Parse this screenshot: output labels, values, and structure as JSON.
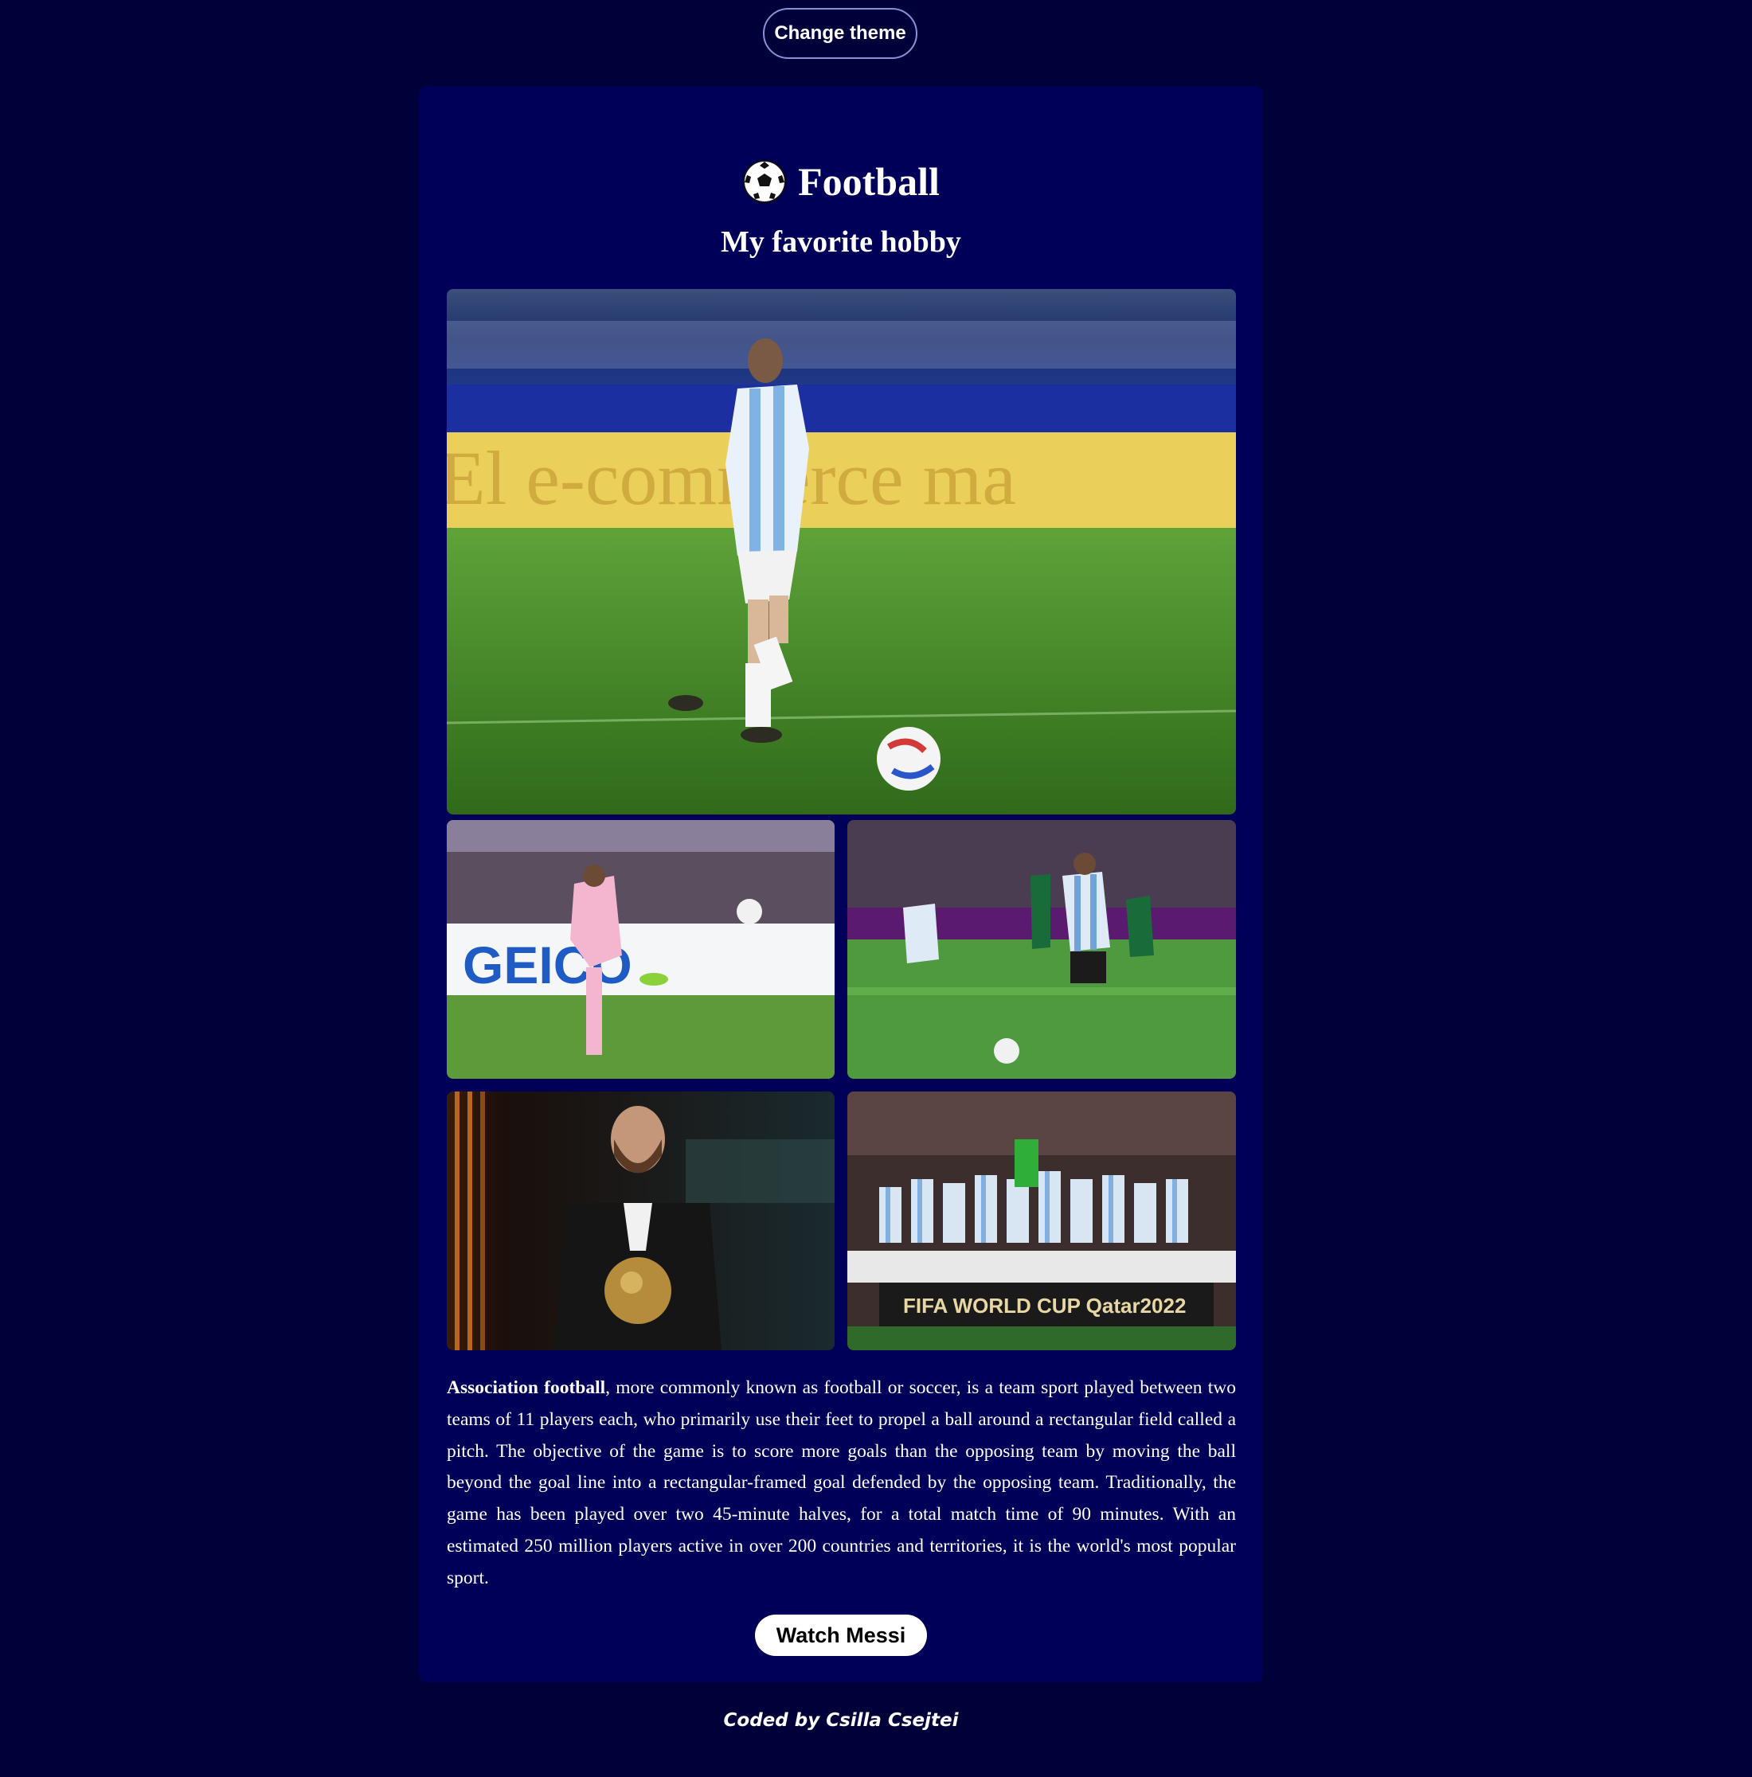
{
  "header": {
    "theme_button_label": "Change theme"
  },
  "card": {
    "title_icon": "soccer-ball-icon",
    "title": "Football",
    "subtitle": "My favorite hobby",
    "gallery": [
      {
        "name": "photo-messi-dribbling-copa-america"
      },
      {
        "name": "photo-messi-free-kick-inter-miami"
      },
      {
        "name": "photo-messi-penalty-world-cup"
      },
      {
        "name": "photo-messi-ballon-dor"
      },
      {
        "name": "photo-argentina-world-cup-celebration"
      }
    ],
    "photo_texts": {
      "main_banner": "El e-commerce ma",
      "a_banner": "GEICO",
      "d_banner": "FIFA WORLD CUP Qatar2022"
    },
    "description_bold": "Association football",
    "description_rest": ", more commonly known as football or soccer, is a team sport played between two teams of 11 players each, who primarily use their feet to propel a ball around a rectangular field called a pitch. The objective of the game is to score more goals than the opposing team by moving the ball beyond the goal line into a rectangular-framed goal defended by the opposing team. Traditionally, the game has been played over two 45-minute halves, for a total match time of 90 minutes. With an estimated 250 million players active in over 200 countries and territories, it is the world's most popular sport.",
    "watch_button_label": "Watch Messi"
  },
  "footer": {
    "credit": "Coded by Csilla Csejtei"
  },
  "colors": {
    "page_background": "#01013a",
    "card_background": "#000058",
    "button_border": "#8a8fd6",
    "text": "#ffffff"
  }
}
